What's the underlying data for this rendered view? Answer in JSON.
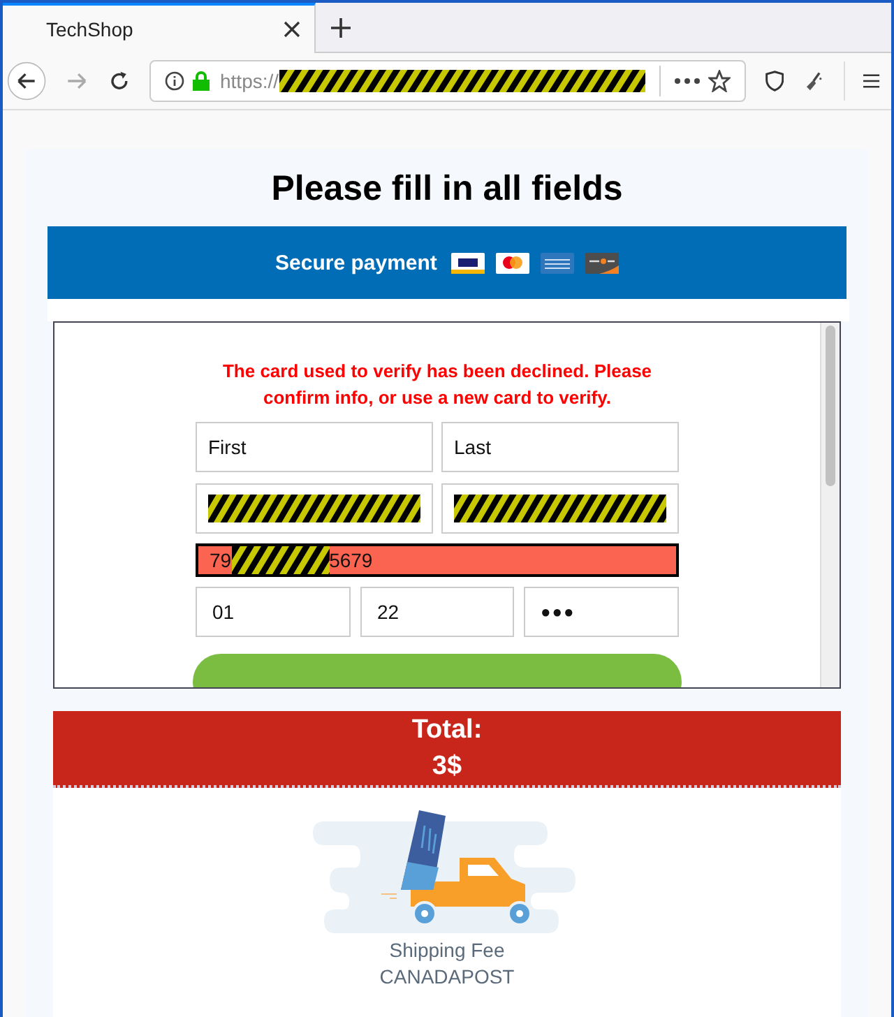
{
  "browser": {
    "tab": {
      "title": "TechShop",
      "selected": true
    },
    "address": {
      "scheme": "https://",
      "redacted": true
    }
  },
  "page": {
    "heading": "Please fill in all fields",
    "payment_bar": {
      "title": "Secure payment"
    },
    "form": {
      "error": "The card used to verify has been declined. Please confirm info, or use a new card to verify.",
      "fields": [
        {
          "kind": "text",
          "value": "First"
        },
        {
          "kind": "text",
          "value": "Last"
        },
        {
          "kind": "redacted"
        },
        {
          "kind": "redacted"
        }
      ],
      "card_number": {
        "start": "79",
        "end": "5679",
        "redacted": true,
        "error": true
      },
      "short_fields": [
        {
          "value": "01"
        },
        {
          "value": "22"
        },
        {
          "value": "●●●"
        }
      ]
    },
    "total": {
      "label": "Total:",
      "amount": "3$"
    },
    "shipping": {
      "label": "Shipping Fee",
      "carrier": "CANADAPOST"
    }
  }
}
